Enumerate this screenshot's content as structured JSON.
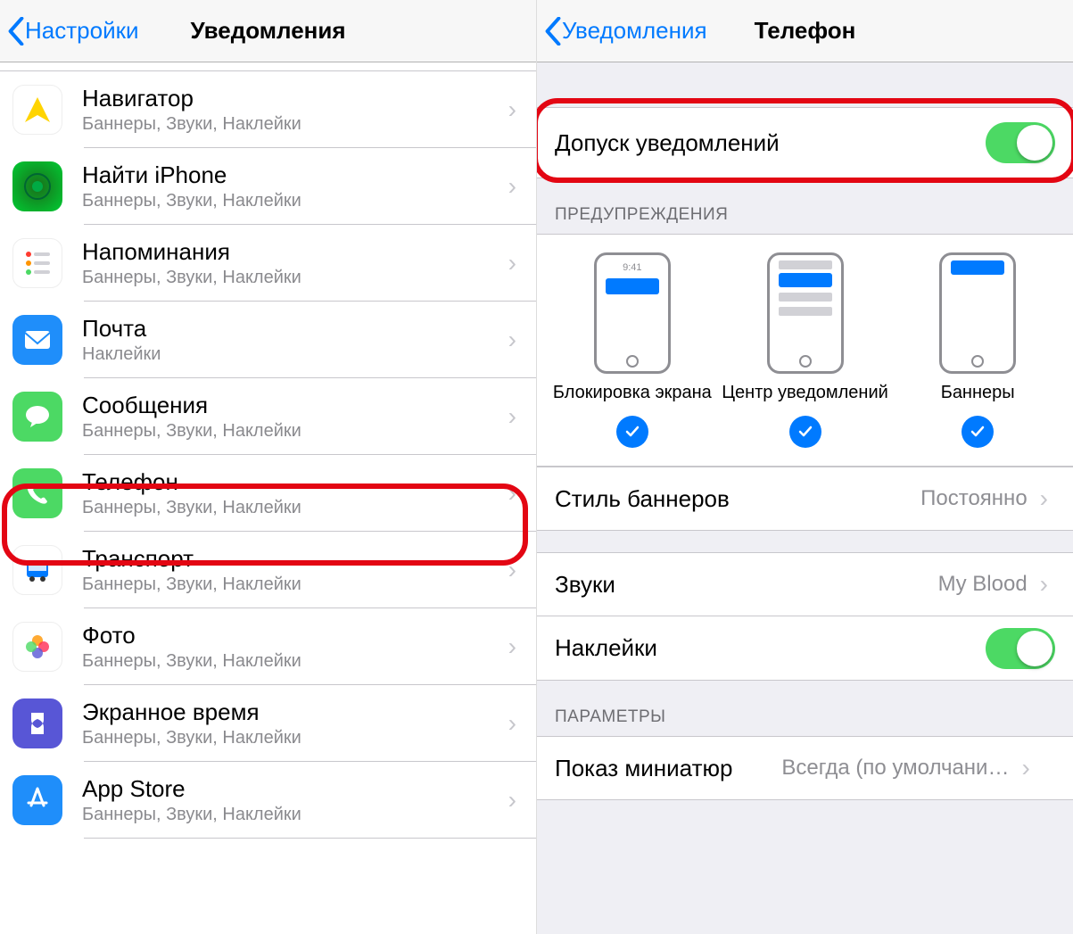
{
  "left": {
    "back_label": "Настройки",
    "title": "Уведомления",
    "apps": [
      {
        "name": "Навигатор",
        "detail": "Баннеры, Звуки, Наклейки",
        "icon": "navigator"
      },
      {
        "name": "Найти iPhone",
        "detail": "Баннеры, Звуки, Наклейки",
        "icon": "find"
      },
      {
        "name": "Напоминания",
        "detail": "Баннеры, Звуки, Наклейки",
        "icon": "reminders"
      },
      {
        "name": "Почта",
        "detail": "Наклейки",
        "icon": "mail"
      },
      {
        "name": "Сообщения",
        "detail": "Баннеры, Звуки, Наклейки",
        "icon": "messages"
      },
      {
        "name": "Телефон",
        "detail": "Баннеры, Звуки, Наклейки",
        "icon": "phone",
        "highlighted": true
      },
      {
        "name": "Транспорт",
        "detail": "Баннеры, Звуки, Наклейки",
        "icon": "transport"
      },
      {
        "name": "Фото",
        "detail": "Баннеры, Звуки, Наклейки",
        "icon": "photos"
      },
      {
        "name": "Экранное время",
        "detail": "Баннеры, Звуки, Наклейки",
        "icon": "screentime"
      },
      {
        "name": "App Store",
        "detail": "Баннеры, Звуки, Наклейки",
        "icon": "appstore"
      }
    ]
  },
  "right": {
    "back_label": "Уведомления",
    "title": "Телефон",
    "allow_label": "Допуск уведомлений",
    "allow_on": true,
    "alerts_header": "ПРЕДУПРЕЖДЕНИЯ",
    "alerts": {
      "lock": "Блокировка экрана",
      "center": "Центр уведомлений",
      "banners": "Баннеры",
      "mock_time": "9:41"
    },
    "banner_style_label": "Стиль баннеров",
    "banner_style_value": "Постоянно",
    "sounds_label": "Звуки",
    "sounds_value": "My Blood",
    "badges_label": "Наклейки",
    "params_header": "ПАРАМЕТРЫ",
    "preview_label": "Показ миниатюр",
    "preview_value": "Всегда (по умолчани…"
  }
}
